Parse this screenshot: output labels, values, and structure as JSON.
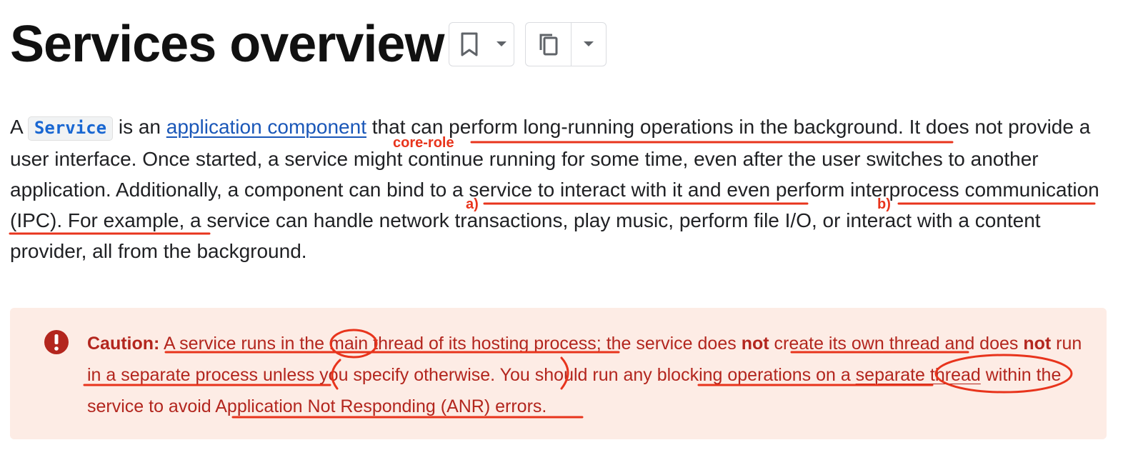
{
  "header": {
    "title": "Services overview",
    "bookmark_icon": "bookmark-icon",
    "copy_icon": "copy-icon",
    "dropdown_icon": "arrow-drop-down-icon"
  },
  "intro": {
    "t1": "A ",
    "code": "Service",
    "t2": " is an ",
    "link": "application component",
    "t3": " that can perform long-running operations in the background. It does not provide a user interface. Once started, a service might continue running for some time, even after the user switches to another application. Additionally, a component can bind to a service to interact with it and even perform interprocess communication (IPC). For example, a service can handle network transactions, play music, perform file I/O, or interact with a content provider, all from the background."
  },
  "caution": {
    "icon": "error-icon",
    "label": "Caution:",
    "t1": " A service runs in the main thread of its hosting process; the service does ",
    "not1": "not",
    "t2": " create its own thread and does ",
    "not2": "not",
    "t3": " run in a separate process unless you specify otherwise. You should run any blocking operations on a ",
    "link": "separate thread",
    "t4": " within the service to avoid Application Not Responding (ANR) errors."
  },
  "annotations": {
    "core_role": "core-role",
    "a": "a)",
    "b": "b)",
    "color": "#e8341c"
  },
  "colors": {
    "link": "#1a57b8",
    "code": "#1967d2",
    "caution_bg": "#fdece5",
    "caution_text": "#b3261e"
  }
}
